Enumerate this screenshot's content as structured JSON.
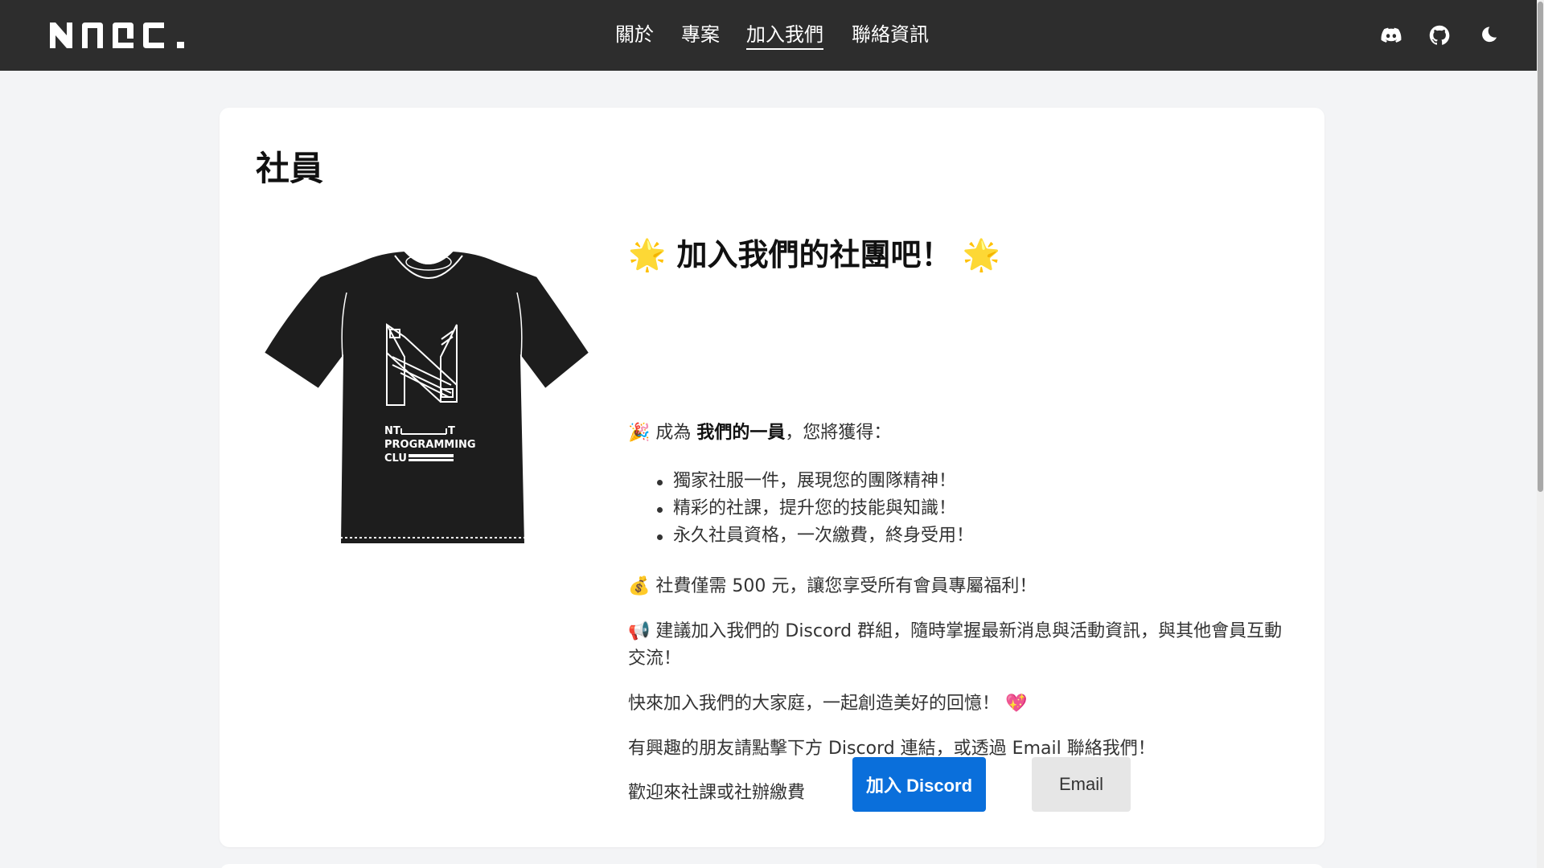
{
  "header": {
    "logo_alt": "NNAC logo",
    "nav": [
      {
        "label": "關於"
      },
      {
        "label": "專案"
      },
      {
        "label": "加入我們",
        "active": true
      },
      {
        "label": "聯絡資訊"
      }
    ],
    "icons": [
      "discord-icon",
      "github-icon",
      "moon-icon"
    ]
  },
  "card": {
    "title": "社員",
    "tshirt_text": {
      "line1": "NT",
      "line1_end": "T",
      "line2": "PROGRAMMING",
      "line3": "CLU"
    },
    "headline": "🌟 加入我們的社團吧！ 🌟",
    "intro_prefix": "🎉 成為 ",
    "intro_bold": "我們的一員",
    "intro_suffix": "，您將獲得：",
    "perks": [
      "獨家社服一件，展現您的團隊精神！",
      "精彩的社課，提升您的技能與知識！",
      "永久社員資格，一次繳費，終身受用！"
    ],
    "fee": "💰 社費僅需 500 元，讓您享受所有會員專屬福利！",
    "discord_note": "📢 建議加入我們的 Discord 群組，隨時掌握最新消息與活動資訊，與其他會員互動交流！",
    "family": "快來加入我們的大家庭，一起創造美好的回憶！ 💖",
    "contact": "有興趣的朋友請點擊下方 Discord 連結，或透過 Email 聯絡我們！",
    "welcome": "歡迎來社課或社辦繳費",
    "buttons": {
      "discord": "加入 Discord",
      "email": "Email"
    }
  },
  "colors": {
    "header_bg": "#2d2d2d",
    "page_bg": "#f3f4f6",
    "primary": "#0a6fdb"
  }
}
